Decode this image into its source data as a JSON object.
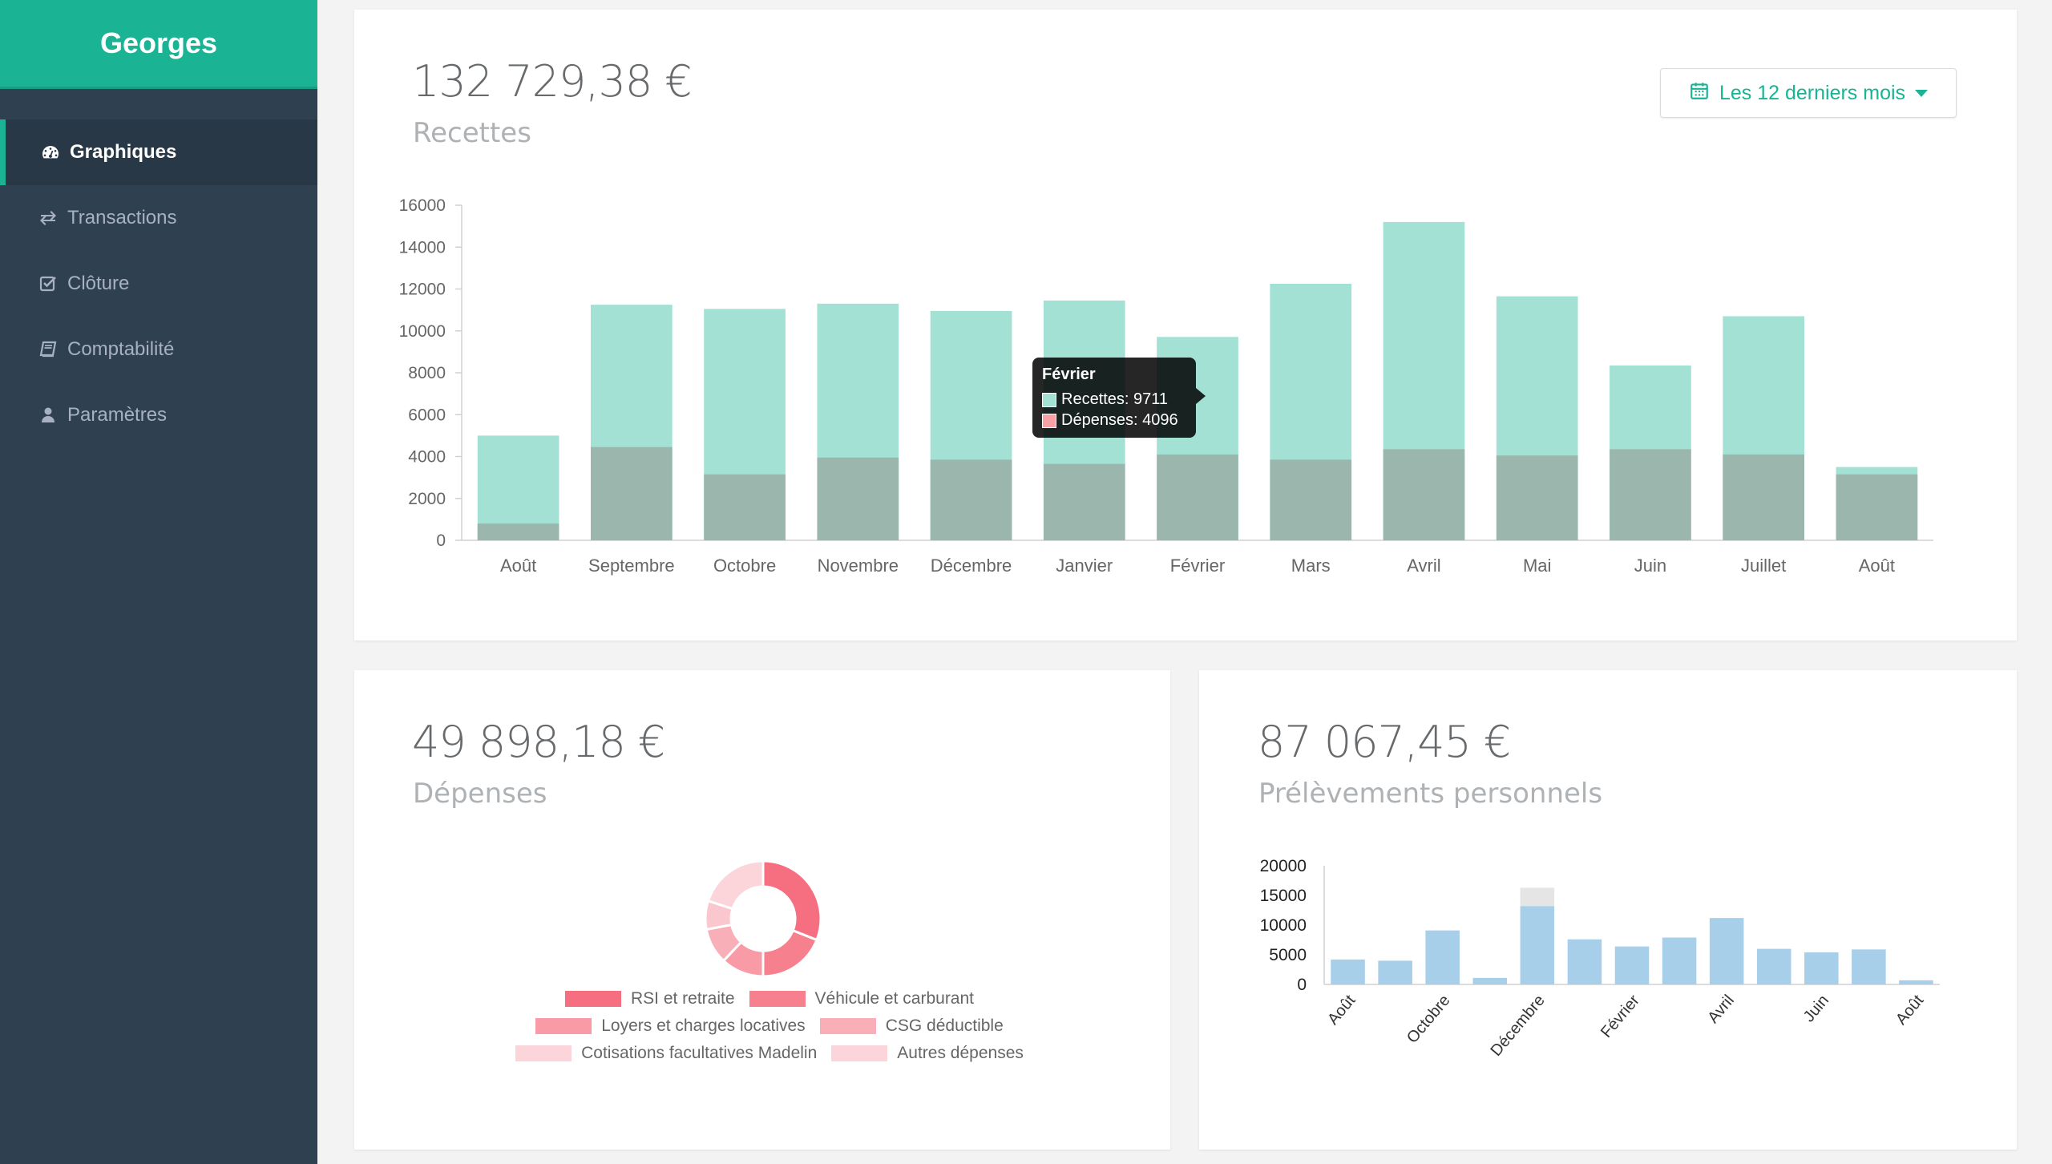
{
  "app": {
    "brand": "Georges"
  },
  "sidebar": {
    "items": [
      {
        "label": "Graphiques",
        "icon": "dashboard-icon",
        "active": true
      },
      {
        "label": "Transactions",
        "icon": "exchange-icon",
        "active": false
      },
      {
        "label": "Clôture",
        "icon": "check-square-icon",
        "active": false
      },
      {
        "label": "Comptabilité",
        "icon": "book-icon",
        "active": false
      },
      {
        "label": "Paramètres",
        "icon": "user-icon",
        "active": false
      }
    ]
  },
  "revenue": {
    "amount": "132 729,38 €",
    "label": "Recettes",
    "period_button": "Les 12 derniers mois",
    "tooltip": {
      "title": "Février",
      "recettes_label": "Recettes: 9711",
      "depenses_label": "Dépenses: 4096"
    }
  },
  "expenses": {
    "amount": "49 898,18 €",
    "label": "Dépenses"
  },
  "withdrawals": {
    "amount": "87 067,45 €",
    "label": "Prélèvements personnels"
  },
  "colors": {
    "accent": "#1ab394",
    "sidebar": "#2f4050",
    "recettes": "#a3e1d4",
    "depenses": "#9bb7ad",
    "blue_bars": "#a7cfea",
    "grey_bar": "#e5e5e5"
  },
  "chart_data": [
    {
      "type": "bar",
      "categories": [
        "Août",
        "Septembre",
        "Octobre",
        "Novembre",
        "Décembre",
        "Janvier",
        "Février",
        "Mars",
        "Avril",
        "Mai",
        "Juin",
        "Juillet",
        "Août"
      ],
      "series": [
        {
          "name": "Recettes",
          "values": [
            5000,
            11250,
            11050,
            11300,
            10950,
            11450,
            9711,
            12250,
            15200,
            11650,
            8350,
            10700,
            3500
          ],
          "color": "#a3e1d4"
        },
        {
          "name": "Dépenses",
          "values": [
            800,
            4450,
            3150,
            3950,
            3850,
            3650,
            4096,
            3850,
            4350,
            4050,
            4350,
            4100,
            3150
          ],
          "color": "#9bb7ad"
        }
      ],
      "ylim": [
        0,
        16000
      ],
      "yticks": [
        0,
        2000,
        4000,
        6000,
        8000,
        10000,
        12000,
        14000,
        16000
      ],
      "grid": false,
      "legend": "none"
    },
    {
      "type": "pie",
      "categories": [
        "RSI et retraite",
        "Véhicule et carburant",
        "Loyers et charges locatives",
        "CSG déductible",
        "Cotisations facultatives Madelin",
        "Autres dépenses"
      ],
      "values": [
        31,
        19,
        12,
        10,
        8,
        20
      ],
      "colors": [
        "#f66f81",
        "#f7808f",
        "#f89ba7",
        "#f9afb8",
        "#fac7ce",
        "#fcd5da"
      ],
      "legend": "bottom"
    },
    {
      "type": "bar",
      "categories": [
        "Août",
        "Septembre",
        "Octobre",
        "Novembre",
        "Décembre",
        "Janvier",
        "Février",
        "Mars",
        "Avril",
        "Mai",
        "Juin",
        "Juillet",
        "Août"
      ],
      "tick_labels": [
        "Août",
        "",
        "Octobre",
        "",
        "Décembre",
        "",
        "Février",
        "",
        "Avril",
        "",
        "Juin",
        "",
        "Août"
      ],
      "series": [
        {
          "values": [
            4200,
            4000,
            9100,
            1100,
            13200,
            7600,
            6400,
            7900,
            11200,
            6000,
            5400,
            5900,
            700
          ],
          "color": "#a7cfea"
        },
        {
          "values": [
            0,
            0,
            0,
            0,
            3100,
            0,
            0,
            0,
            0,
            0,
            0,
            0,
            0
          ],
          "color": "#e5e5e5"
        }
      ],
      "ylim": [
        0,
        20000
      ],
      "yticks": [
        0,
        5000,
        10000,
        15000,
        20000
      ],
      "grid": false,
      "legend": "none"
    }
  ]
}
